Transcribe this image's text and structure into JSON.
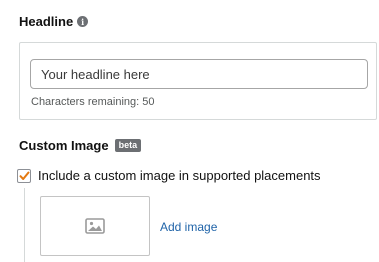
{
  "headline": {
    "label": "Headline",
    "info_icon": "info-icon",
    "input_placeholder": "Your headline here",
    "input_value": "",
    "chars_remaining": "Characters remaining: 50"
  },
  "custom_image": {
    "heading": "Custom Image",
    "badge": "beta",
    "checkbox_label": "Include a custom image in supported placements",
    "checkbox_checked": true,
    "placeholder_icon": "image-icon",
    "add_image_link": "Add image"
  },
  "colors": {
    "checkmark": "#e47911",
    "link": "#1f63a8",
    "badge_bg": "#6c6f73"
  }
}
